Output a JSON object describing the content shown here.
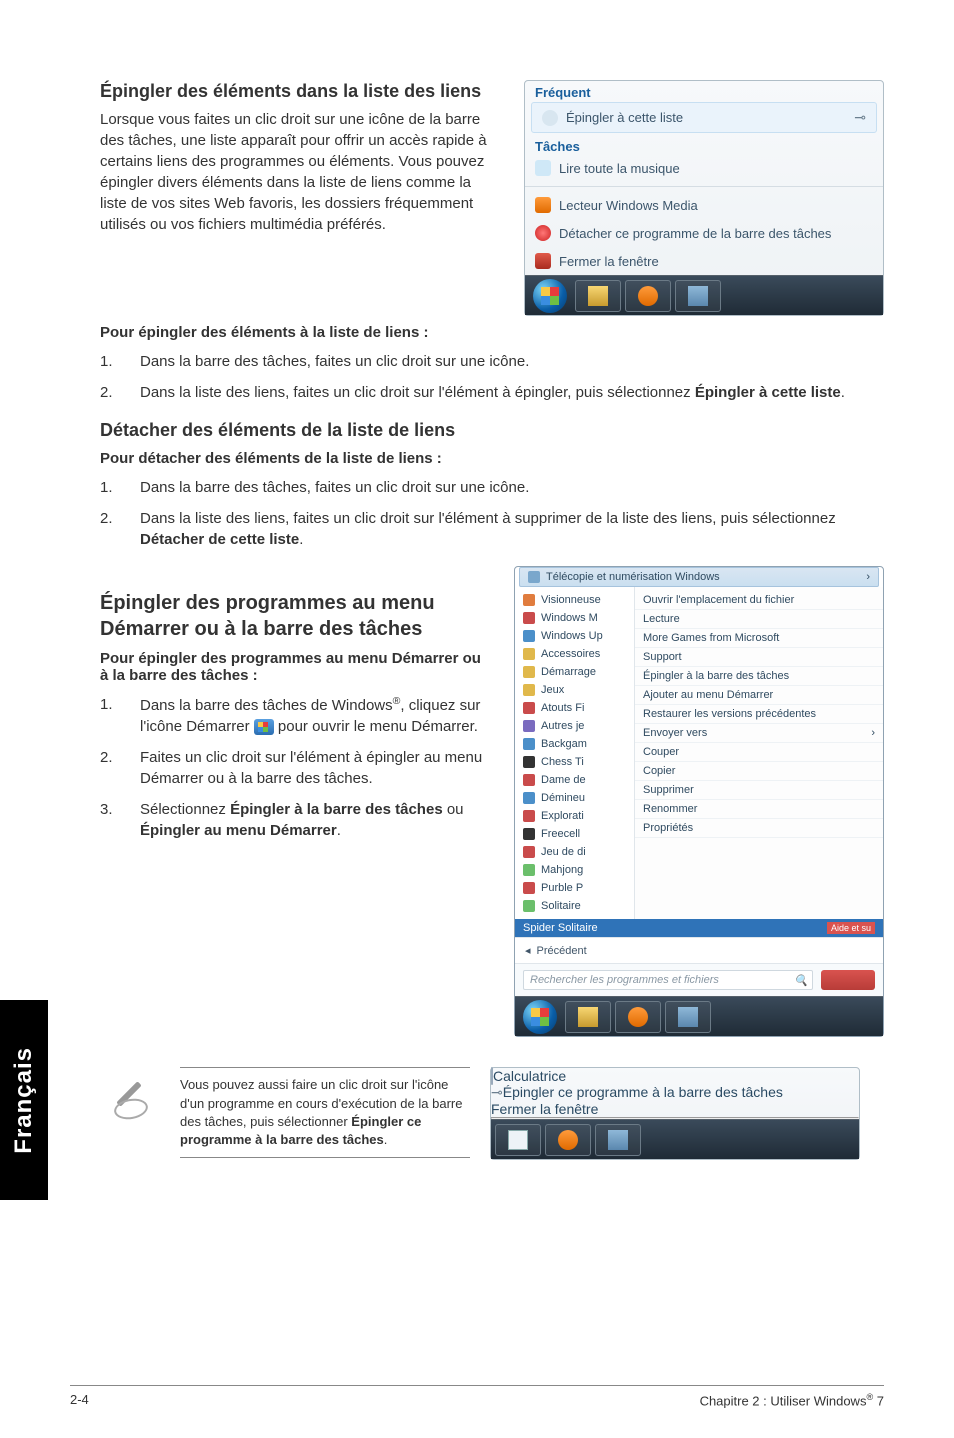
{
  "side_tab": "Français",
  "sec1": {
    "title": "Épingler des éléments dans la liste des liens",
    "para": "Lorsque vous faites un clic droit sur une icône de la barre des tâches, une liste apparaît pour offrir un accès rapide à certains liens des programmes ou éléments. Vous pouvez épingler divers éléments dans la liste de liens comme la liste de vos sites Web favoris, les dossiers fréquemment utilisés ou vos fichiers multimédia préférés.",
    "sub": "Pour épingler des éléments à la liste de liens :",
    "steps": [
      "Dans la barre des tâches, faites un clic droit sur une icône.",
      "Dans la liste des liens, faites un clic droit sur l'élément à épingler, puis sélectionnez "
    ],
    "bold2": "Épingler à cette liste",
    "period2": "."
  },
  "sec2": {
    "title": "Détacher des éléments de la liste de liens",
    "sub": "Pour détacher des éléments de la liste de liens :",
    "steps": [
      "Dans la barre des tâches, faites un clic droit sur une icône.",
      "Dans la liste des liens, faites un clic droit sur l'élément à supprimer de la liste des liens, puis sélectionnez "
    ],
    "bold2": "Détacher de cette liste",
    "period2": "."
  },
  "sec3": {
    "title": "Épingler des programmes au menu Démarrer ou à la barre des tâches",
    "sub": "Pour épingler des programmes au menu Démarrer ou à la barre des tâches :",
    "step1a": "Dans la barre des tâches de Windows",
    "step1b": ", cliquez sur l'icône Démarrer ",
    "step1c": " pour ouvrir le menu Démarrer.",
    "step2": "Faites un clic droit sur l'élément à épingler au menu Démarrer ou à la barre des tâches.",
    "step3a": "Sélectionnez ",
    "step3b": "Épingler à la barre des tâches",
    "step3c": " ou ",
    "step3d": "Épingler au menu Démarrer",
    "step3e": "."
  },
  "note": {
    "a": "Vous pouvez aussi faire un clic droit sur l'icône d'un programme en cours d'exécution de la barre des tâches, puis sélectionner ",
    "b": "Épingler ce programme à la barre des tâches",
    "c": "."
  },
  "jumplist": {
    "freq": "Fréquent",
    "pinrow": "Épingler à cette liste",
    "taches": "Tâches",
    "lire": "Lire toute la musique",
    "lecteur": "Lecteur Windows Media",
    "detach": "Détacher ce programme de la barre des tâches",
    "fermer": "Fermer la fenêtre"
  },
  "startmenu": {
    "header": "Télécopie et numérisation Windows",
    "left": [
      "Visionneuse",
      "Windows M",
      "Windows Up",
      "Accessoires",
      "Démarrage",
      "Jeux",
      "Atouts Fi",
      "Autres je",
      "Backgam",
      "Chess Ti",
      "Dame de",
      "Démineu",
      "Explorati",
      "Freecell",
      "Jeu de di",
      "Mahjong",
      "Purble P",
      "Solitaire"
    ],
    "right": [
      "Ouvrir l'emplacement du fichier",
      "Lecture",
      "More Games from Microsoft",
      "Support",
      "Épingler à la barre des tâches",
      "Ajouter au menu Démarrer",
      "Restaurer les versions précédentes",
      "Envoyer vers",
      "Couper",
      "Copier",
      "Supprimer",
      "Renommer",
      "Propriétés"
    ],
    "hl": "Spider Solitaire",
    "hltag": "Aide et su",
    "prev": "Précédent",
    "search": "Rechercher les programmes et fichiers"
  },
  "calcmenu": {
    "calc": "Calculatrice",
    "pin": "Épingler ce programme à la barre des tâches",
    "close": "Fermer la fenêtre"
  },
  "footer": {
    "left": "2-4",
    "right_a": "Chapitre 2 : Utiliser Windows",
    "right_b": " 7"
  }
}
